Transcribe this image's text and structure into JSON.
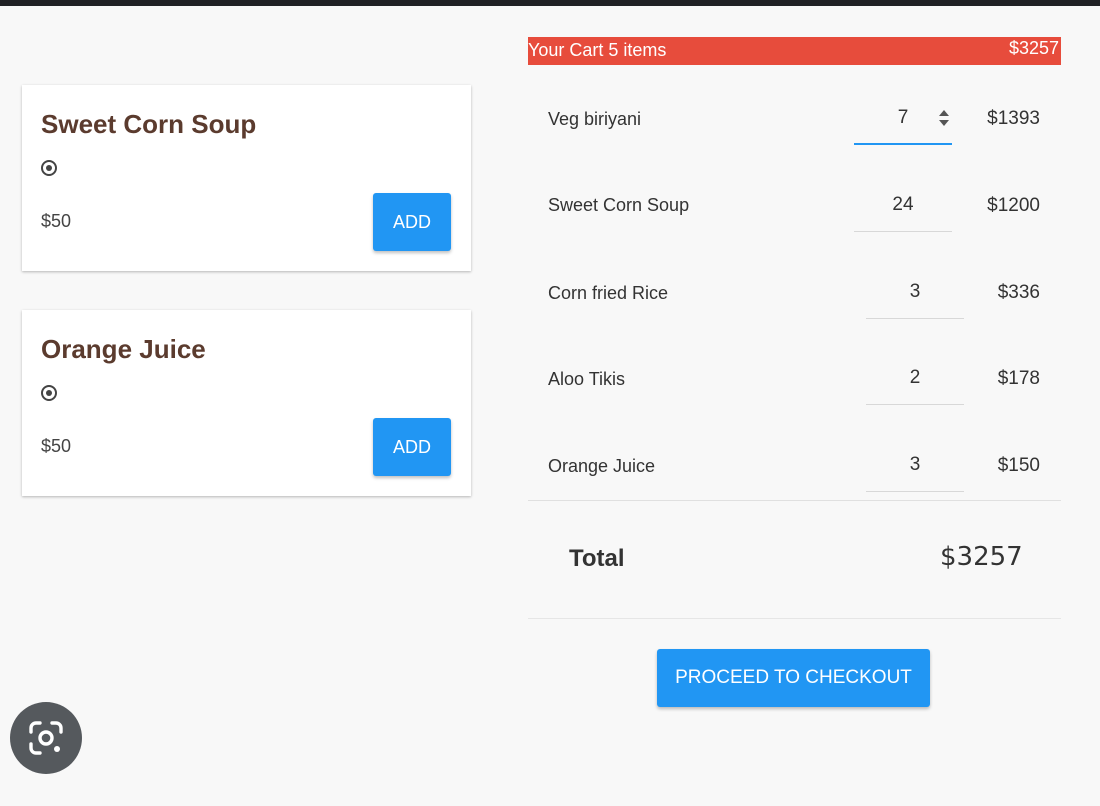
{
  "products": [
    {
      "title": "Sweet Corn Soup",
      "price": "$50",
      "add_label": "ADD",
      "icon": "veg-indicator-icon"
    },
    {
      "title": "Orange Juice",
      "price": "$50",
      "add_label": "ADD",
      "icon": "veg-indicator-icon"
    }
  ],
  "cart": {
    "header_count": "Your Cart 5 items",
    "header_total": "$3257",
    "header_color": "#e74c3c",
    "items": [
      {
        "name": "Veg biriyani",
        "qty": "7",
        "price": "$1393"
      },
      {
        "name": "Sweet Corn Soup",
        "qty": "24",
        "price": "$1200"
      },
      {
        "name": "Corn fried Rice",
        "qty": "3",
        "price": "$336"
      },
      {
        "name": "Aloo Tikis",
        "qty": "2",
        "price": "$178"
      },
      {
        "name": "Orange Juice",
        "qty": "3",
        "price": "$150"
      }
    ],
    "total_label": "Total",
    "total_value": "$3257",
    "checkout_label": "PROCEED TO CHECKOUT"
  },
  "colors": {
    "accent": "#2196f3",
    "title": "#5b3b2e"
  },
  "overlay": {
    "icon": "lens-camera-icon"
  }
}
